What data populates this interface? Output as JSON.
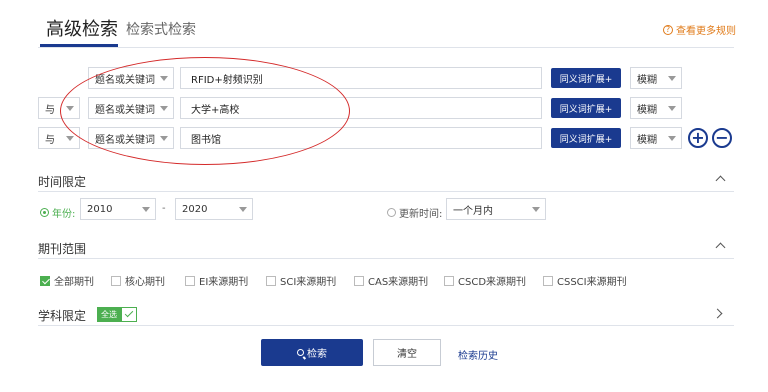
{
  "tabs": {
    "active": "高级检索",
    "inactive": "检索式检索"
  },
  "more_rules": "查看更多规则",
  "rows": [
    {
      "logic": "",
      "field": "题名或关键词",
      "value": "RFID+射频识别",
      "synonym": "同义词扩展+",
      "match": "模糊"
    },
    {
      "logic": "与",
      "field": "题名或关键词",
      "value": "大学+高校",
      "synonym": "同义词扩展+",
      "match": "模糊"
    },
    {
      "logic": "与",
      "field": "题名或关键词",
      "value": "图书馆",
      "synonym": "同义词扩展+",
      "match": "模糊"
    }
  ],
  "add_symbol": "+",
  "remove_symbol": "−",
  "time": {
    "title": "时间限定",
    "year_label": "年份:",
    "year_from": "2010",
    "dash": "-",
    "year_to": "2020",
    "update_label": "更新时间:",
    "update_value": "一个月内"
  },
  "journal": {
    "title": "期刊范围",
    "options": [
      {
        "label": "全部期刊",
        "checked": true
      },
      {
        "label": "核心期刊",
        "checked": false
      },
      {
        "label": "EI来源期刊",
        "checked": false
      },
      {
        "label": "SCI来源期刊",
        "checked": false
      },
      {
        "label": "CAS来源期刊",
        "checked": false
      },
      {
        "label": "CSCD来源期刊",
        "checked": false
      },
      {
        "label": "CSSCI来源期刊",
        "checked": false
      }
    ]
  },
  "subject": {
    "title": "学科限定",
    "all_label": "全选"
  },
  "actions": {
    "search": "检索",
    "clear": "清空",
    "history": "检索历史"
  },
  "colors": {
    "primary": "#1a3a8f",
    "accent_orange": "#e07b1a",
    "check_green": "#4caf50",
    "annotation_red": "#d42a2a"
  }
}
